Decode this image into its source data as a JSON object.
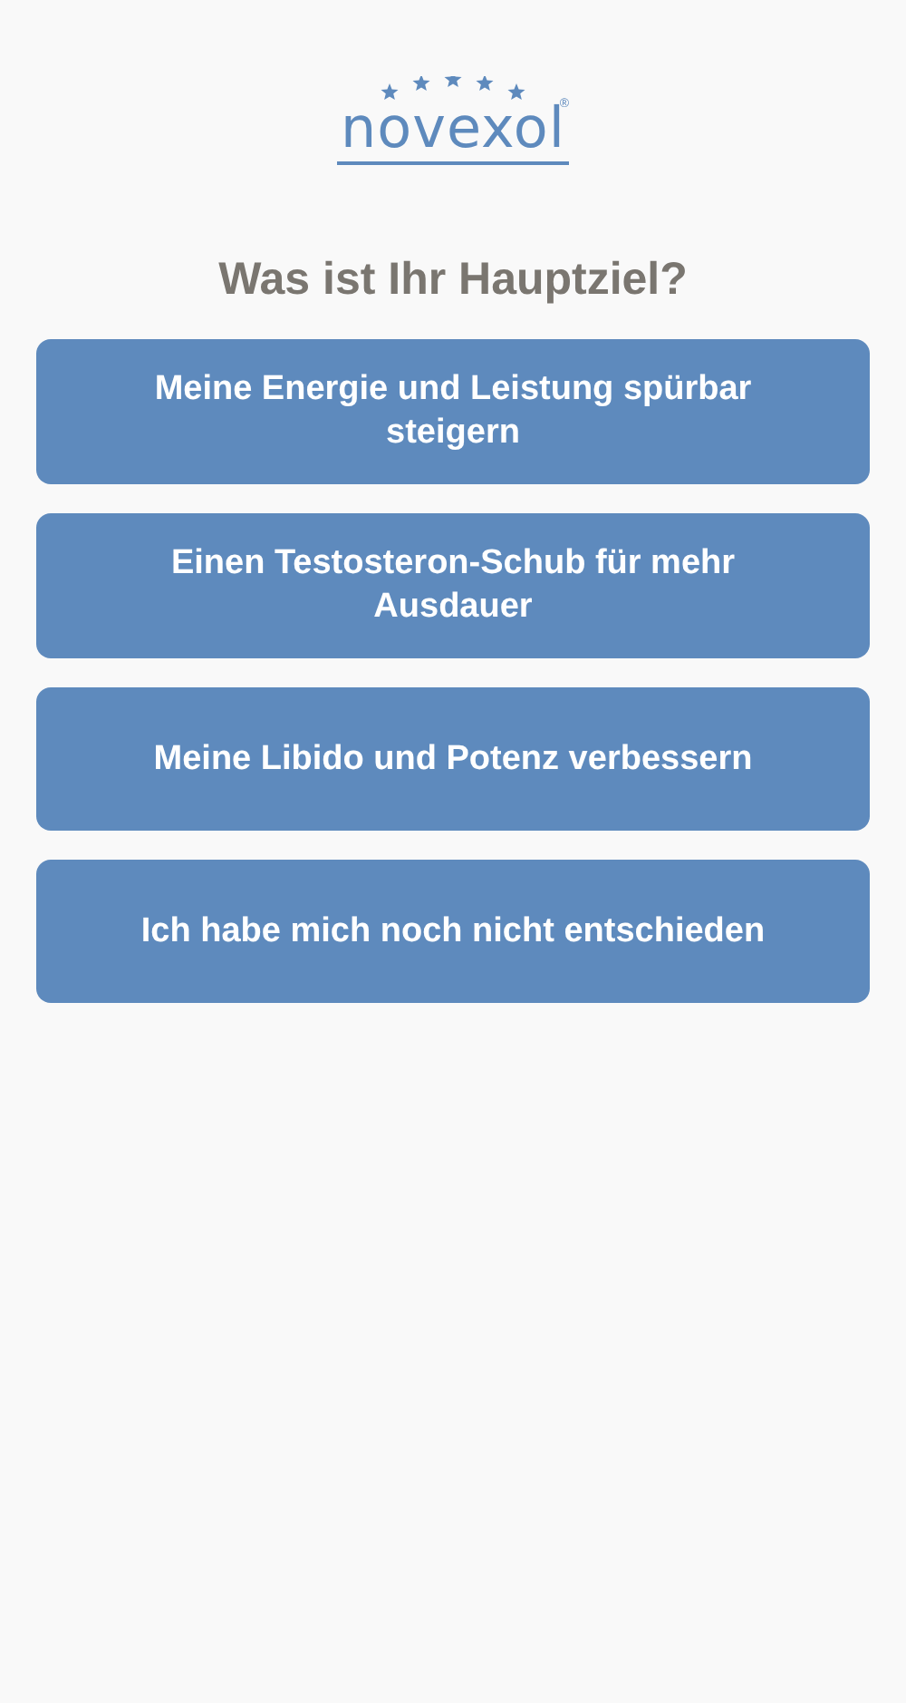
{
  "logo": {
    "text": "novexol",
    "mark": "®"
  },
  "title": "Was ist Ihr Hauptziel?",
  "options": [
    {
      "label": "Meine Energie und Leistung spürbar steigern"
    },
    {
      "label": "Einen Testosteron-Schub für mehr Ausdauer"
    },
    {
      "label": "Meine Libido und Potenz verbessern"
    },
    {
      "label": "Ich habe mich noch nicht entschieden"
    }
  ]
}
